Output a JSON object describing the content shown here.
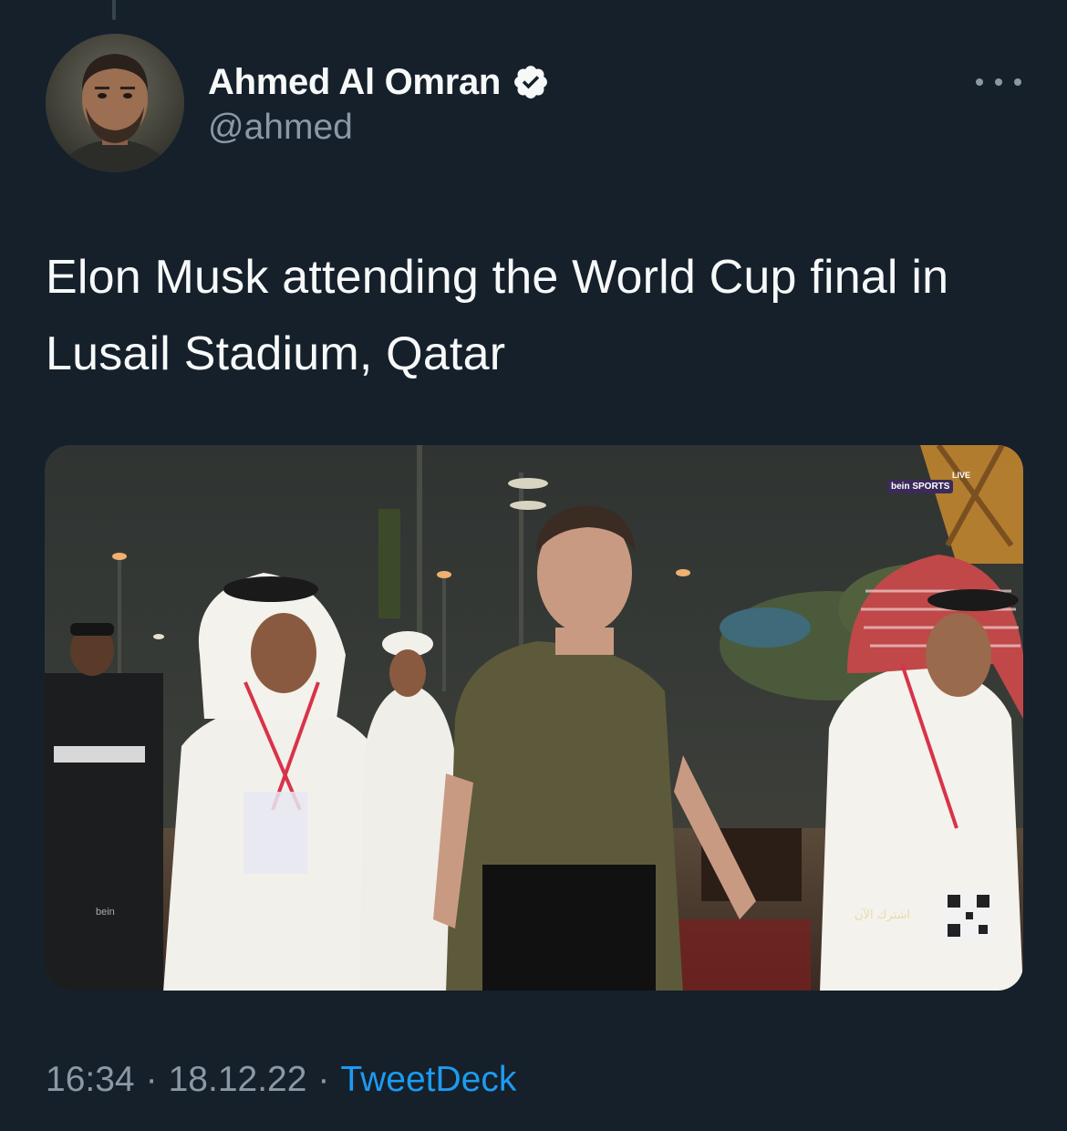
{
  "tweet": {
    "author_name": "Ahmed Al Omran",
    "handle": "@ahmed",
    "text": "Elon Musk attending the World Cup final in Lusail Stadium, Qatar",
    "time": "16:34",
    "date": "18.12.22",
    "separator": "·",
    "source": "TweetDeck"
  },
  "media": {
    "broadcaster_logo": "bein SPORTS",
    "live_badge": "LIVE",
    "bottom_left_logo": "bein",
    "arabic_caption": "اشترك الآن"
  },
  "icons": {
    "verified": "verified-badge-icon",
    "more": "more-options-icon"
  },
  "colors": {
    "background": "#15202b",
    "primary_text": "#f7f9f9",
    "secondary_text": "#8b98a5",
    "accent": "#1d9bf0"
  }
}
